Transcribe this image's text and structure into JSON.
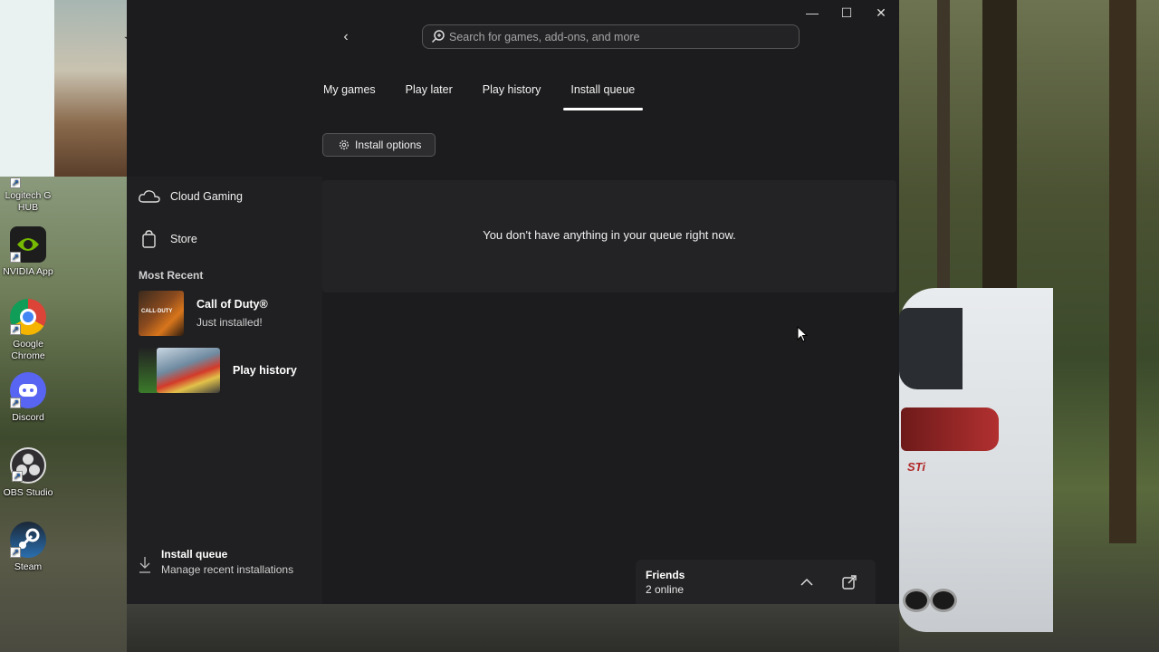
{
  "window": {
    "minimize_icon": "minimize-icon",
    "maximize_icon": "maximize-icon",
    "close_icon": "close-icon"
  },
  "search": {
    "placeholder": "Search for games, add-ons, and more"
  },
  "tabs": [
    {
      "label": "My games",
      "active": false
    },
    {
      "label": "Play later",
      "active": false
    },
    {
      "label": "Play history",
      "active": false
    },
    {
      "label": "Install queue",
      "active": true
    }
  ],
  "toolbar": {
    "install_options_label": "Install options"
  },
  "queue": {
    "empty_message": "You don't have anything in your queue right now."
  },
  "sidebar": {
    "cloud_gaming_label": "Cloud Gaming",
    "store_label": "Store",
    "most_recent_title": "Most Recent",
    "recent": [
      {
        "title": "Call of Duty®",
        "subtitle": "Just installed!"
      },
      {
        "title": "Play history",
        "subtitle": ""
      }
    ],
    "footer": {
      "title": "Install queue",
      "subtitle": "Manage recent installations"
    }
  },
  "friends": {
    "title": "Friends",
    "status": "2 online"
  },
  "desktop_icons": [
    {
      "label": "Logitech G HUB"
    },
    {
      "label": "NVIDIA App"
    },
    {
      "label": "Google Chrome"
    },
    {
      "label": "Discord"
    },
    {
      "label": "OBS Studio"
    },
    {
      "label": "Steam"
    }
  ],
  "colors": {
    "app_bg": "#1c1c1e",
    "panel_bg": "#232325",
    "accent": "#ffffff"
  }
}
